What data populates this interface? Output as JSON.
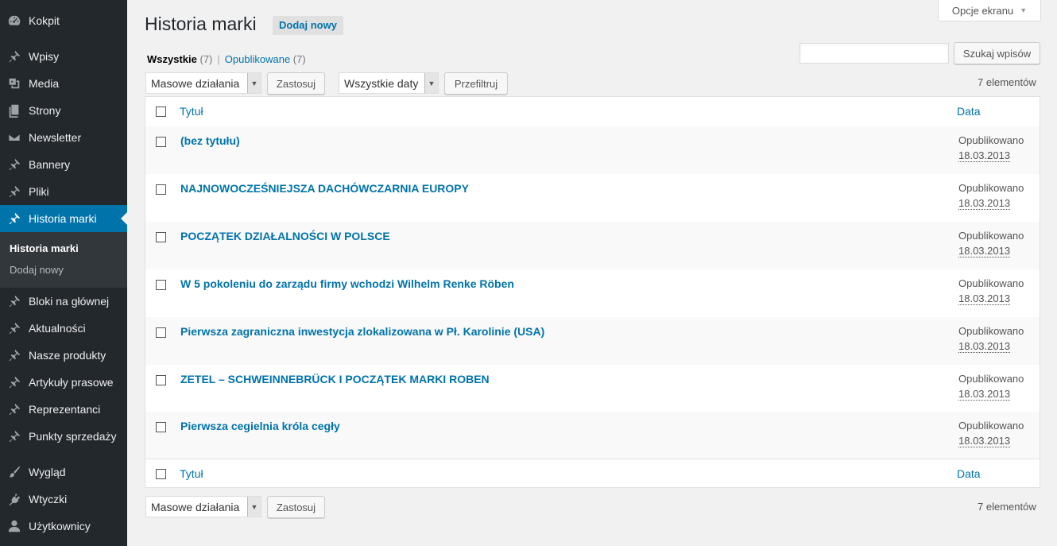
{
  "sidebar": {
    "items": [
      {
        "label": "Kokpit",
        "icon": "dashboard-icon"
      },
      {
        "label": "Wpisy",
        "icon": "pin-icon"
      },
      {
        "label": "Media",
        "icon": "media-icon"
      },
      {
        "label": "Strony",
        "icon": "page-icon"
      },
      {
        "label": "Newsletter",
        "icon": "mail-icon"
      },
      {
        "label": "Bannery",
        "icon": "pin-icon"
      },
      {
        "label": "Pliki",
        "icon": "pin-icon"
      },
      {
        "label": "Historia marki",
        "icon": "pin-icon",
        "active": true
      },
      {
        "label": "Bloki na głównej",
        "icon": "pin-icon"
      },
      {
        "label": "Aktualności",
        "icon": "pin-icon"
      },
      {
        "label": "Nasze produkty",
        "icon": "pin-icon"
      },
      {
        "label": "Artykuły prasowe",
        "icon": "pin-icon"
      },
      {
        "label": "Reprezentanci",
        "icon": "pin-icon"
      },
      {
        "label": "Punkty sprzedaży",
        "icon": "pin-icon"
      },
      {
        "label": "Wygląd",
        "icon": "brush-icon"
      },
      {
        "label": "Wtyczki",
        "icon": "plugin-icon"
      },
      {
        "label": "Użytkownicy",
        "icon": "user-icon"
      }
    ],
    "submenu": [
      {
        "label": "Historia marki",
        "current": true
      },
      {
        "label": "Dodaj nowy"
      }
    ]
  },
  "header": {
    "title": "Historia marki",
    "add_new": "Dodaj nowy",
    "screen_options": "Opcje ekranu"
  },
  "views": {
    "all_label": "Wszystkie",
    "all_count": "(7)",
    "separator": "|",
    "published_label": "Opublikowane",
    "published_count": "(7)"
  },
  "search": {
    "value": "",
    "button": "Szukaj wpisów"
  },
  "toolbar": {
    "bulk_actions": "Masowe działania",
    "apply": "Zastosuj",
    "all_dates": "Wszystkie daty",
    "filter": "Przefiltruj",
    "items_count": "7 elementów"
  },
  "table": {
    "columns": {
      "title": "Tytuł",
      "date": "Data"
    },
    "rows": [
      {
        "title": "(bez tytułu)",
        "status": "Opublikowano",
        "date": "18.03.2013"
      },
      {
        "title": "NAJNOWOCZEŚNIEJSZA DACHÓWCZARNIA EUROPY",
        "status": "Opublikowano",
        "date": "18.03.2013"
      },
      {
        "title": "POCZĄTEK DZIAŁALNOŚCI W POLSCE",
        "status": "Opublikowano",
        "date": "18.03.2013"
      },
      {
        "title": "W 5 pokoleniu do zarządu firmy wchodzi Wilhelm Renke Röben",
        "status": "Opublikowano",
        "date": "18.03.2013"
      },
      {
        "title": "Pierwsza zagraniczna inwestycja zlokalizowana w Pł. Karolinie (USA)",
        "status": "Opublikowano",
        "date": "18.03.2013"
      },
      {
        "title": "ZETEL – SCHWEINNEBRÜCK I POCZĄTEK MARKI ROBEN",
        "status": "Opublikowano",
        "date": "18.03.2013"
      },
      {
        "title": "Pierwsza cegielnia króla cegły",
        "status": "Opublikowano",
        "date": "18.03.2013"
      }
    ]
  },
  "colors": {
    "sidebar_bg": "#23282d",
    "active": "#0073aa",
    "link": "#0073aa"
  }
}
